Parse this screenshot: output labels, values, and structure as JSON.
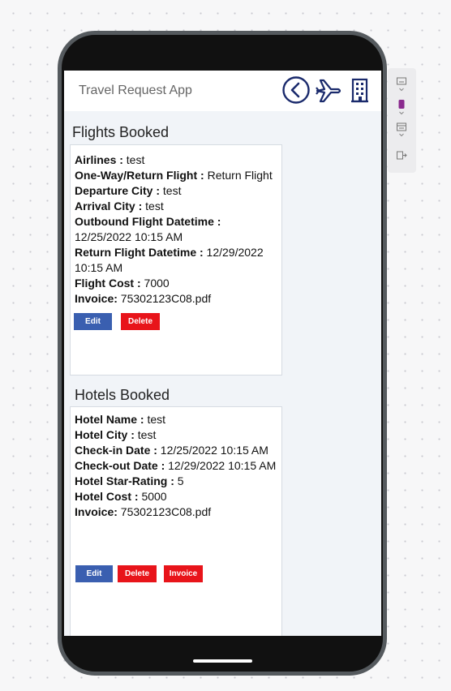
{
  "app": {
    "title": "Travel Request App"
  },
  "header_icons": [
    "back-arrow-icon",
    "airplane-icon",
    "building-icon"
  ],
  "flights": {
    "section_title": "Flights Booked",
    "fields": [
      {
        "label": "Airlines :",
        "value": " test"
      },
      {
        "label": "One-Way/Return Flight :",
        "value": " Return Flight"
      },
      {
        "label": "Departure City :",
        "value": " test"
      },
      {
        "label": "Arrival City :",
        "value": " test"
      },
      {
        "label": "Outbound Flight Datetime :",
        "value": " 12/25/2022 10:15 AM"
      },
      {
        "label": "Return Flight Datetime :",
        "value": " 12/29/2022 10:15 AM"
      },
      {
        "label": "Flight Cost :",
        "value": " 7000"
      },
      {
        "label": "Invoice:",
        "value": " 75302123C08.pdf"
      }
    ],
    "buttons": {
      "edit": "Edit",
      "delete": "Delete"
    }
  },
  "hotels": {
    "section_title": "Hotels Booked",
    "fields": [
      {
        "label": "Hotel Name :",
        "value": " test"
      },
      {
        "label": "Hotel City :",
        "value": " test"
      },
      {
        "label": "Check-in Date :",
        "value": " 12/25/2022 10:15 AM"
      },
      {
        "label": "Check-out Date :",
        "value": " 12/29/2022 10:15 AM"
      },
      {
        "label": "Hotel Star-Rating :",
        "value": " 5"
      },
      {
        "label": "Hotel Cost :",
        "value": " 5000"
      },
      {
        "label": "Invoice:",
        "value": " 75302123C08.pdf"
      }
    ],
    "buttons": {
      "edit": "Edit",
      "delete": "Delete",
      "invoice": "Invoice"
    }
  },
  "side_panel_icons": [
    "screen-icon",
    "phone-icon",
    "layout-icon",
    "preview-icon"
  ],
  "colors": {
    "accent_blue": "#3a5fb0",
    "danger_red": "#e8141a",
    "header_icon_navy": "#1a2a6c"
  }
}
